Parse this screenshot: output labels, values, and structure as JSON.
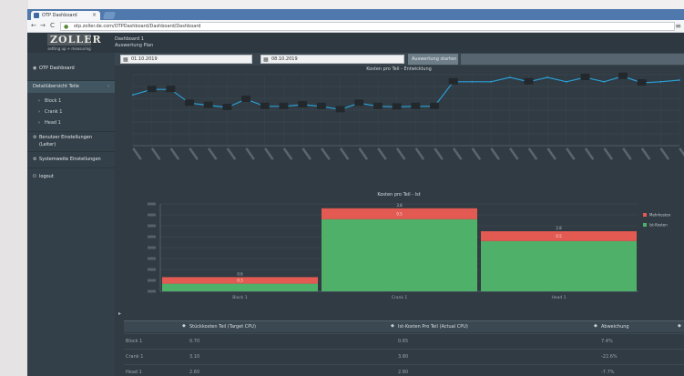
{
  "browser": {
    "tab_title": "OTP Dashboard",
    "tab_close": "×",
    "url": "otp.zoller.de.com/OTPDashboard/Dashboard/Dashboard",
    "back": "←",
    "forward": "→",
    "reload": "C",
    "menu": "≡"
  },
  "header": {
    "logo_text": "ZOLLER",
    "logo_tagline": "setting up + measuring",
    "breadcrumb_line1": "Dashboard 1",
    "breadcrumb_line2": "Auswertung Plan"
  },
  "sidebar": {
    "items": [
      {
        "icon": "◉",
        "label": "OTP Dashboard"
      },
      {
        "icon": "",
        "label": "Detailübersicht Teile",
        "chevron": "‹"
      },
      {
        "icon": "›",
        "label": "Block 1"
      },
      {
        "icon": "›",
        "label": "Crank 1"
      },
      {
        "icon": "›",
        "label": "Head 1"
      },
      {
        "icon": "⚙",
        "label": "Benutzer Einstellungen"
      },
      {
        "icon": "",
        "label": "(Leiter)"
      },
      {
        "icon": "⚙",
        "label": "Systemweite Einstellungen"
      },
      {
        "icon": "⏻",
        "label": "logout"
      }
    ]
  },
  "filters": {
    "from": "01.10.2019",
    "to": "08.10.2019",
    "apply_label": "Auswertung starten"
  },
  "line_chart": {
    "title": "Kosten pro Teil - Entwicklung"
  },
  "bar_chart": {
    "title": "Kosten pro Teil - Ist"
  },
  "chart_data": [
    {
      "type": "line",
      "title": "Kosten pro Teil - Entwicklung",
      "values": [
        0.93,
        1.03,
        1.03,
        0.78,
        0.74,
        0.7,
        0.85,
        0.72,
        0.72,
        0.75,
        0.72,
        0.66,
        0.78,
        0.72,
        0.71,
        0.72,
        0.72,
        1.17,
        1.17,
        1.17,
        1.25,
        1.17,
        1.25,
        1.17,
        1.25,
        1.17,
        1.27,
        1.15,
        1.17,
        1.2
      ],
      "labeled_points": [
        1,
        2,
        3,
        4,
        5,
        6,
        7,
        8,
        9,
        10,
        11,
        12,
        13,
        14,
        15,
        16,
        17,
        21,
        24,
        26,
        27
      ],
      "ylim": [
        0,
        1.3
      ]
    },
    {
      "type": "bar",
      "title": "Kosten pro Teil - Ist",
      "categories": [
        "Block 1",
        "Crank 1",
        "Head 1"
      ],
      "series": [
        {
          "name": "Ist-Kosten",
          "values": [
            0.35,
            3.3,
            2.3
          ],
          "color": "#4fb06a"
        },
        {
          "name": "Mehrkosten",
          "values": [
            0.3,
            0.5,
            0.45
          ],
          "color": "#e35a52"
        }
      ],
      "total_labels": [
        "0.6",
        "3.8",
        "2.8"
      ],
      "segment_labels": [
        "0.3",
        "0.5",
        "0.5"
      ],
      "legend": "right",
      "ylim": [
        0,
        4
      ]
    }
  ],
  "table": {
    "columns": [
      "Stückkosten Teil (Target CPU)",
      "Ist-Kosten Pro Teil (Actual CPU)",
      "Abweichung"
    ],
    "rows": [
      {
        "name": "Block 1",
        "c1": "0.70",
        "c2": "0.65",
        "c3": "7.4%"
      },
      {
        "name": "Crank 1",
        "c1": "3.10",
        "c2": "3.80",
        "c3": "-22.6%"
      },
      {
        "name": "Head 1",
        "c1": "2.60",
        "c2": "2.80",
        "c3": "-7.7%"
      }
    ]
  }
}
